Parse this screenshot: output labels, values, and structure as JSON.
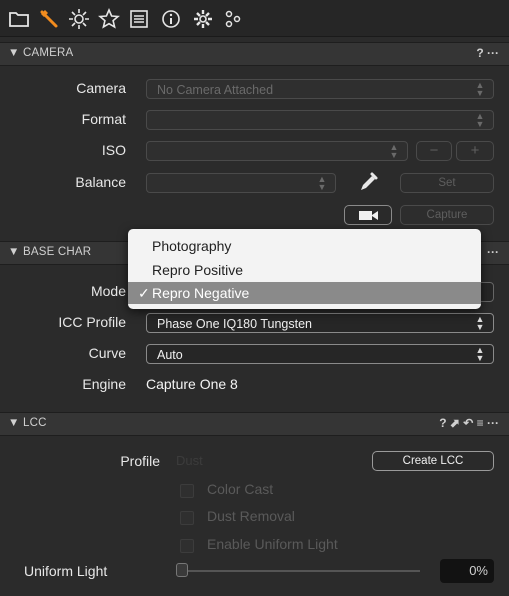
{
  "tabs": [
    "folder-icon",
    "adjust-tool-icon",
    "exposure-icon",
    "star-icon",
    "list-icon",
    "info-icon",
    "settings-icon",
    "sliders-icon"
  ],
  "camera": {
    "title": "▼ CAMERA",
    "tools": "? ···",
    "camera_label": "Camera",
    "camera_value": "No Camera Attached",
    "format_label": "Format",
    "iso_label": "ISO",
    "balance_label": "Balance",
    "minus": "−",
    "plus": "+",
    "set_button": "Set",
    "capture_button": "Capture"
  },
  "base": {
    "title": "▼ BASE CHAR",
    "tools": "···",
    "mode_label": "Mode",
    "mode_options": [
      "Photography",
      "Repro Positive",
      "Repro Negative"
    ],
    "mode_selected": "Repro Negative",
    "check": "✓",
    "icc_label": "ICC Profile",
    "icc_value": "Phase One IQ180 Tungsten",
    "curve_label": "Curve",
    "curve_value": "Auto",
    "engine_label": "Engine",
    "engine_value": "Capture One 8"
  },
  "lcc": {
    "title": "▼ LCC",
    "tools": "? ⬈ ↶ ≡ ···",
    "profile_label": "Profile",
    "profile_value": "Dust",
    "create_button": "Create LCC",
    "color_cast": "Color Cast",
    "dust_removal": "Dust Removal",
    "enable_uniform_light": "Enable Uniform Light",
    "uniform_light_label": "Uniform Light",
    "uniform_light_value": "0%",
    "uniform_light_level": 0
  }
}
